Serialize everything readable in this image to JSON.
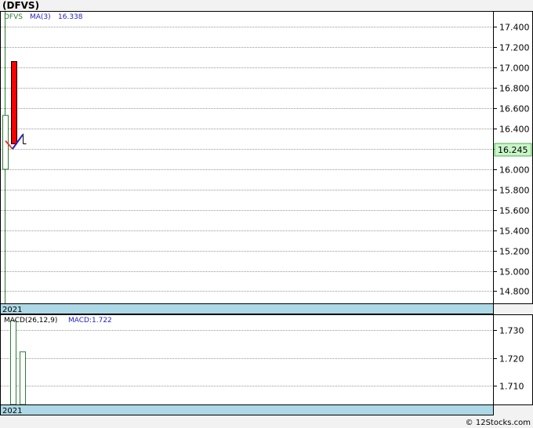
{
  "ticker_title": "(DFVS)",
  "watermark": "© 12Stocks.com",
  "colors": {
    "background": "#f2f2f2",
    "panel_bg": "#ffffff",
    "grid": "#9a9a9a",
    "up_candle": "#2e7d32",
    "down_candle": "#ff0000",
    "ma_line": "#2323c8",
    "price_badge_bg": "#c9f5c9",
    "date_band": "#add8e6",
    "macd_bar": "#2e7d32"
  },
  "chart_data": [
    {
      "type": "candlestick",
      "legend": {
        "symbol": "DFVS",
        "ma_label": "MA(3)",
        "ma_value": "16.338"
      },
      "last_price": 16.245,
      "last_price_label": "16.245",
      "ylim": [
        14.68,
        17.55
      ],
      "y_ticks": [
        "17.400",
        "17.200",
        "17.000",
        "16.800",
        "16.600",
        "16.400",
        "16.200",
        "16.000",
        "15.800",
        "15.600",
        "15.400",
        "15.200",
        "15.000",
        "14.800"
      ],
      "y_tick_values": [
        17.4,
        17.2,
        17.0,
        16.8,
        16.6,
        16.4,
        16.2,
        16.0,
        15.8,
        15.6,
        15.4,
        15.2,
        15.0,
        14.8
      ],
      "x_label": "2021",
      "candles": [
        {
          "open": 14.6,
          "close": 17.55,
          "high": 17.55,
          "low": 14.6,
          "direction": "up"
        },
        {
          "open": 16.0,
          "close": 16.53,
          "high": 16.53,
          "low": 16.0,
          "direction": "up"
        },
        {
          "open": 17.06,
          "close": 16.25,
          "high": 17.06,
          "low": 16.25,
          "direction": "down"
        },
        {
          "open": 16.25,
          "close": 16.3,
          "high": 16.35,
          "low": 16.25,
          "direction": "up"
        }
      ],
      "ma_series": [
        16.29,
        16.2,
        16.34
      ],
      "ma_trail": [
        16.28,
        16.2
      ]
    },
    {
      "type": "bar",
      "legend": {
        "label": "MACD(26,12,9)",
        "value_label": "MACD:1.722"
      },
      "ylim": [
        1.7034,
        1.7353
      ],
      "y_ticks": [
        "1.730",
        "1.720",
        "1.710"
      ],
      "y_tick_values": [
        1.73,
        1.72,
        1.71
      ],
      "x_label": "2021",
      "values": [
        1.7034,
        1.7333,
        1.7222
      ]
    }
  ]
}
